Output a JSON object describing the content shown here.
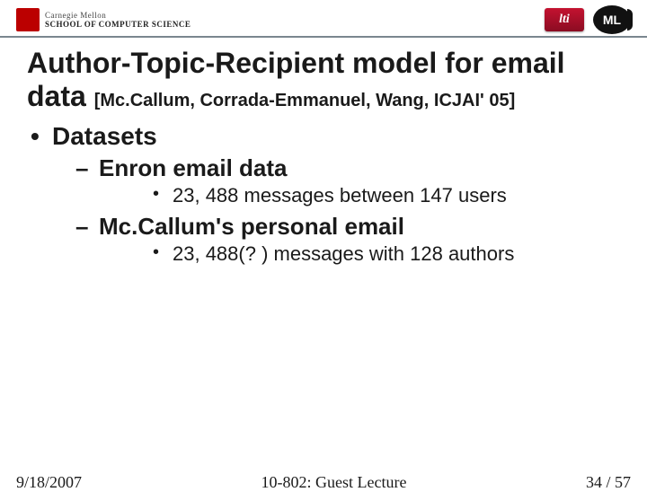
{
  "header": {
    "org_line1": "Carnegie Mellon",
    "org_line2": "SCHOOL OF COMPUTER SCIENCE",
    "lti": "lti",
    "ml": "ML"
  },
  "title_line1": "Author-Topic-Recipient model for email",
  "title_line2_prefix": "data",
  "citation": "[Mc.Callum, Corrada-Emmanuel, Wang, ICJAI' 05]",
  "bullets": {
    "datasets": "Datasets",
    "enron": "Enron email data",
    "enron_detail": "23, 488 messages between 147 users",
    "mccallum": "Mc.Callum's personal email",
    "mccallum_detail": "23, 488(? ) messages with 128 authors"
  },
  "footer": {
    "date": "9/18/2007",
    "center": "10-802: Guest Lecture",
    "page": "34 / 57"
  }
}
